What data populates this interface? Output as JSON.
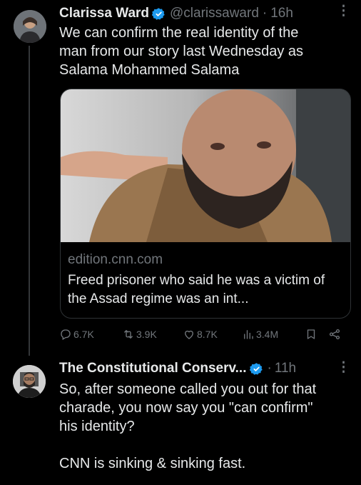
{
  "tweet1": {
    "name": "Clarissa Ward",
    "handle": "@clarissaward",
    "separator": "·",
    "time": "16h",
    "text": "We can confirm the real identity of the\nman from our story last Wednesday as\nSalama Mohammed Salama",
    "card": {
      "domain": "edition.cnn.com",
      "title": "Freed prisoner who said he was a victim of the Assad regime was an int..."
    },
    "actions": {
      "replies": "6.7K",
      "reposts": "3.9K",
      "likes": "8.7K",
      "views": "3.4M"
    }
  },
  "tweet2": {
    "name": "The Constitutional Conserv...",
    "separator": "·",
    "time": "11h",
    "text": "So, after someone called you out for that\ncharade, you now say you \"can confirm\"\nhis identity?\n\nCNN is sinking & sinking fast."
  },
  "colors": {
    "background": "#000000",
    "text": "#e7e9ea",
    "muted": "#71767b",
    "verified": "#1d9bf0",
    "border": "#2f3336"
  },
  "icons": [
    "verified-badge-icon",
    "more-icon",
    "reply-icon",
    "repost-icon",
    "like-icon",
    "views-icon",
    "bookmark-icon",
    "share-icon"
  ]
}
